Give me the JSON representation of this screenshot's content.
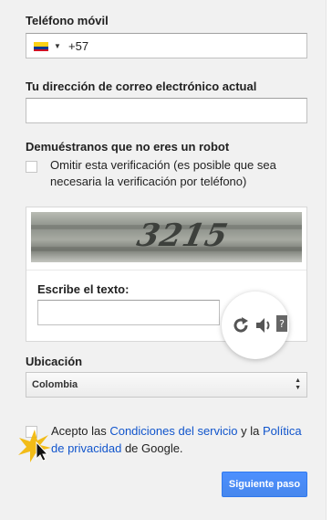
{
  "phone": {
    "label": "Teléfono móvil",
    "country_icon": "colombia-flag-icon",
    "value": "+57"
  },
  "email": {
    "label": "Tu dirección de correo electrónico actual",
    "value": ""
  },
  "robot": {
    "heading": "Demuéstranos que no eres un robot",
    "skip_line1": "Omitir esta verificación (es posible que sea",
    "skip_line2": "necesaria la verificación por teléfono)",
    "captcha_word": "3215",
    "input_label": "Escribe el texto:",
    "input_value": "",
    "refresh_icon": "refresh-icon",
    "audio_icon": "speaker-icon",
    "help_icon": "help-icon"
  },
  "location": {
    "label": "Ubicación",
    "selected": "Colombia"
  },
  "terms": {
    "prefix": "Acepto las ",
    "tos_link": "Condiciones del servicio",
    "middle": " y la ",
    "privacy_link_1": "Política",
    "privacy_link_2": "de privacidad",
    "suffix": " de Google."
  },
  "next_button": "Siguiente paso",
  "colors": {
    "accent": "#4d90fe",
    "link": "#1155cc",
    "cursor_highlight": "#f2b600"
  }
}
